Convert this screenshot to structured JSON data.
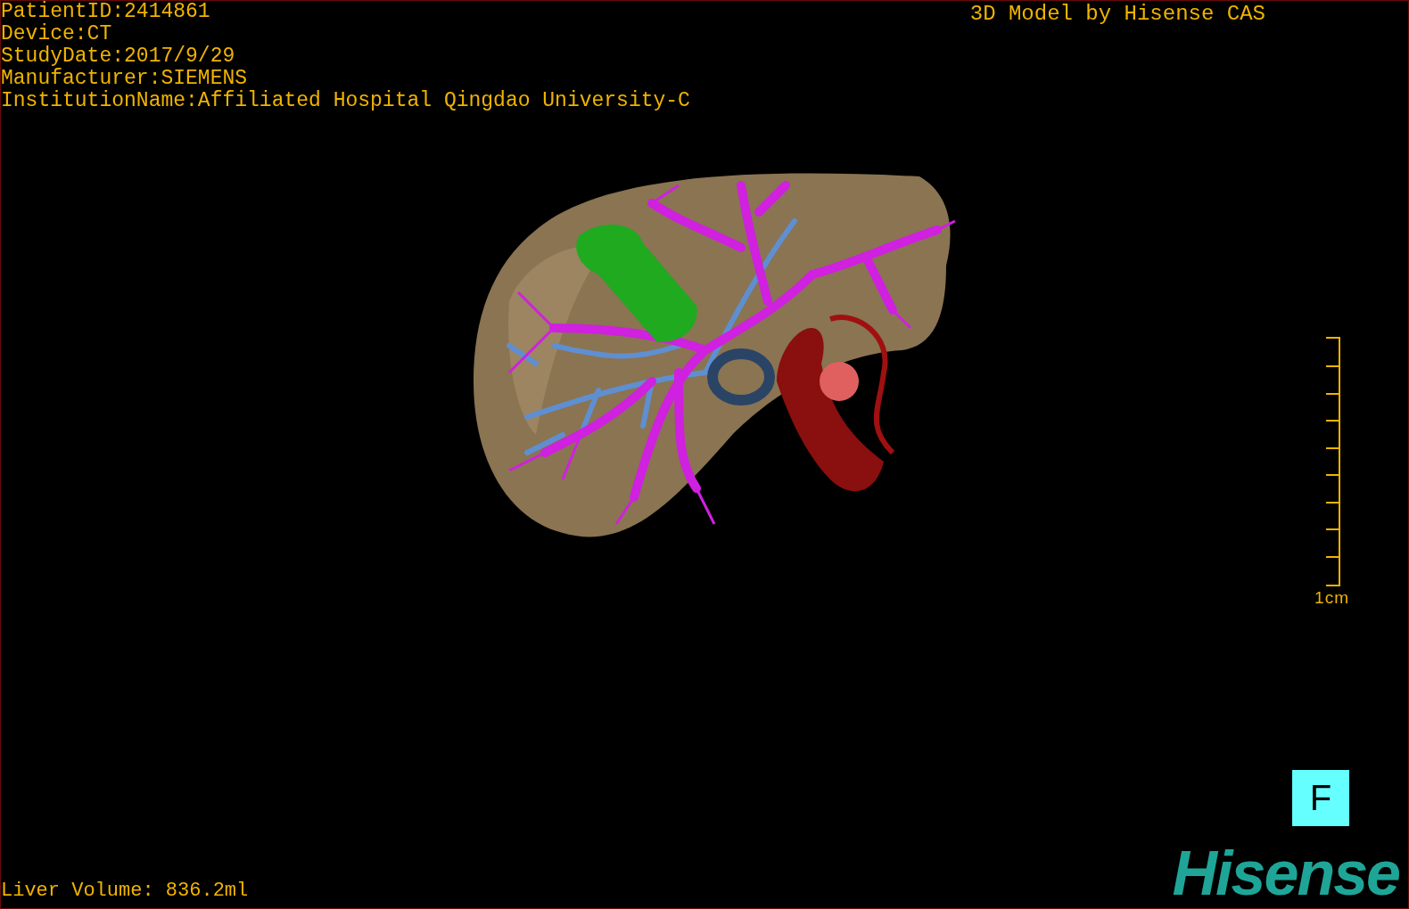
{
  "info_lines": [
    "PatientID:2414861",
    "Device:CT",
    "StudyDate:2017/9/29",
    "Manufacturer:SIEMENS",
    "InstitutionName:Affiliated Hospital Qingdao University-C"
  ],
  "title": "3D Model by Hisense CAS",
  "scale_bar": {
    "label": "1cm"
  },
  "view_button": {
    "label": "F"
  },
  "logo": "Hisense",
  "volume": "Liver Volume: 836.2ml"
}
